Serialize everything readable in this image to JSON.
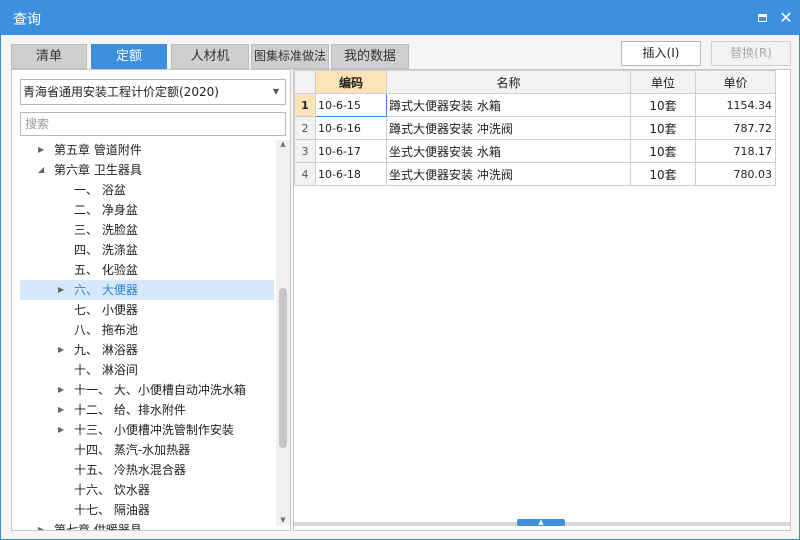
{
  "window": {
    "title": "查询"
  },
  "tabs": [
    {
      "label": "清单"
    },
    {
      "label": "定额"
    },
    {
      "label": "人材机"
    },
    {
      "label": "图集标准做法"
    },
    {
      "label": "我的数据"
    }
  ],
  "actions": {
    "insert_label": "插入(I)",
    "replace_label": "替换(R)"
  },
  "left": {
    "quota_library": "青海省通用安装工程计价定额(2020)",
    "search_placeholder": "搜索",
    "tree": [
      {
        "label": "第五章 管道附件",
        "toggle": "▶"
      },
      {
        "label": "第六章 卫生器具",
        "toggle": "◢"
      },
      {
        "label": "一、  浴盆",
        "toggle": ""
      },
      {
        "label": "二、  净身盆",
        "toggle": ""
      },
      {
        "label": "三、  洗脸盆",
        "toggle": ""
      },
      {
        "label": "四、  洗涤盆",
        "toggle": ""
      },
      {
        "label": "五、  化验盆",
        "toggle": ""
      },
      {
        "label": "六、  大便器",
        "toggle": "▶"
      },
      {
        "label": "七、  小便器",
        "toggle": ""
      },
      {
        "label": "八、  拖布池",
        "toggle": ""
      },
      {
        "label": "九、  淋浴器",
        "toggle": "▶"
      },
      {
        "label": "十、  淋浴间",
        "toggle": ""
      },
      {
        "label": "十一、 大、小便槽自动冲洗水箱",
        "toggle": "▶"
      },
      {
        "label": "十二、 给、排水附件",
        "toggle": "▶"
      },
      {
        "label": "十三、 小便槽冲洗管制作安装",
        "toggle": "▶"
      },
      {
        "label": "十四、 蒸汽-水加热器",
        "toggle": ""
      },
      {
        "label": "十五、 冷热水混合器",
        "toggle": ""
      },
      {
        "label": "十六、 饮水器",
        "toggle": ""
      },
      {
        "label": "十七、 隔油器",
        "toggle": ""
      },
      {
        "label": "第七章 供暖器具",
        "toggle": "▶"
      }
    ]
  },
  "table": {
    "headers": {
      "code": "编码",
      "name": "名称",
      "unit": "单位",
      "price": "单价"
    },
    "rows": [
      {
        "no": "1",
        "code": "10-6-15",
        "name": "蹲式大便器安装 水箱",
        "unit": "10套",
        "price": "1154.34"
      },
      {
        "no": "2",
        "code": "10-6-16",
        "name": "蹲式大便器安装 冲洗阀",
        "unit": "10套",
        "price": "787.72"
      },
      {
        "no": "3",
        "code": "10-6-17",
        "name": "坐式大便器安装 水箱",
        "unit": "10套",
        "price": "718.17"
      },
      {
        "no": "4",
        "code": "10-6-18",
        "name": "坐式大便器安装 冲洗阀",
        "unit": "10套",
        "price": "780.03"
      }
    ]
  },
  "colors": {
    "accent": "#3e8fdd",
    "header_highlight": "#fde4b8",
    "selected_row": "#d6e8fa"
  }
}
